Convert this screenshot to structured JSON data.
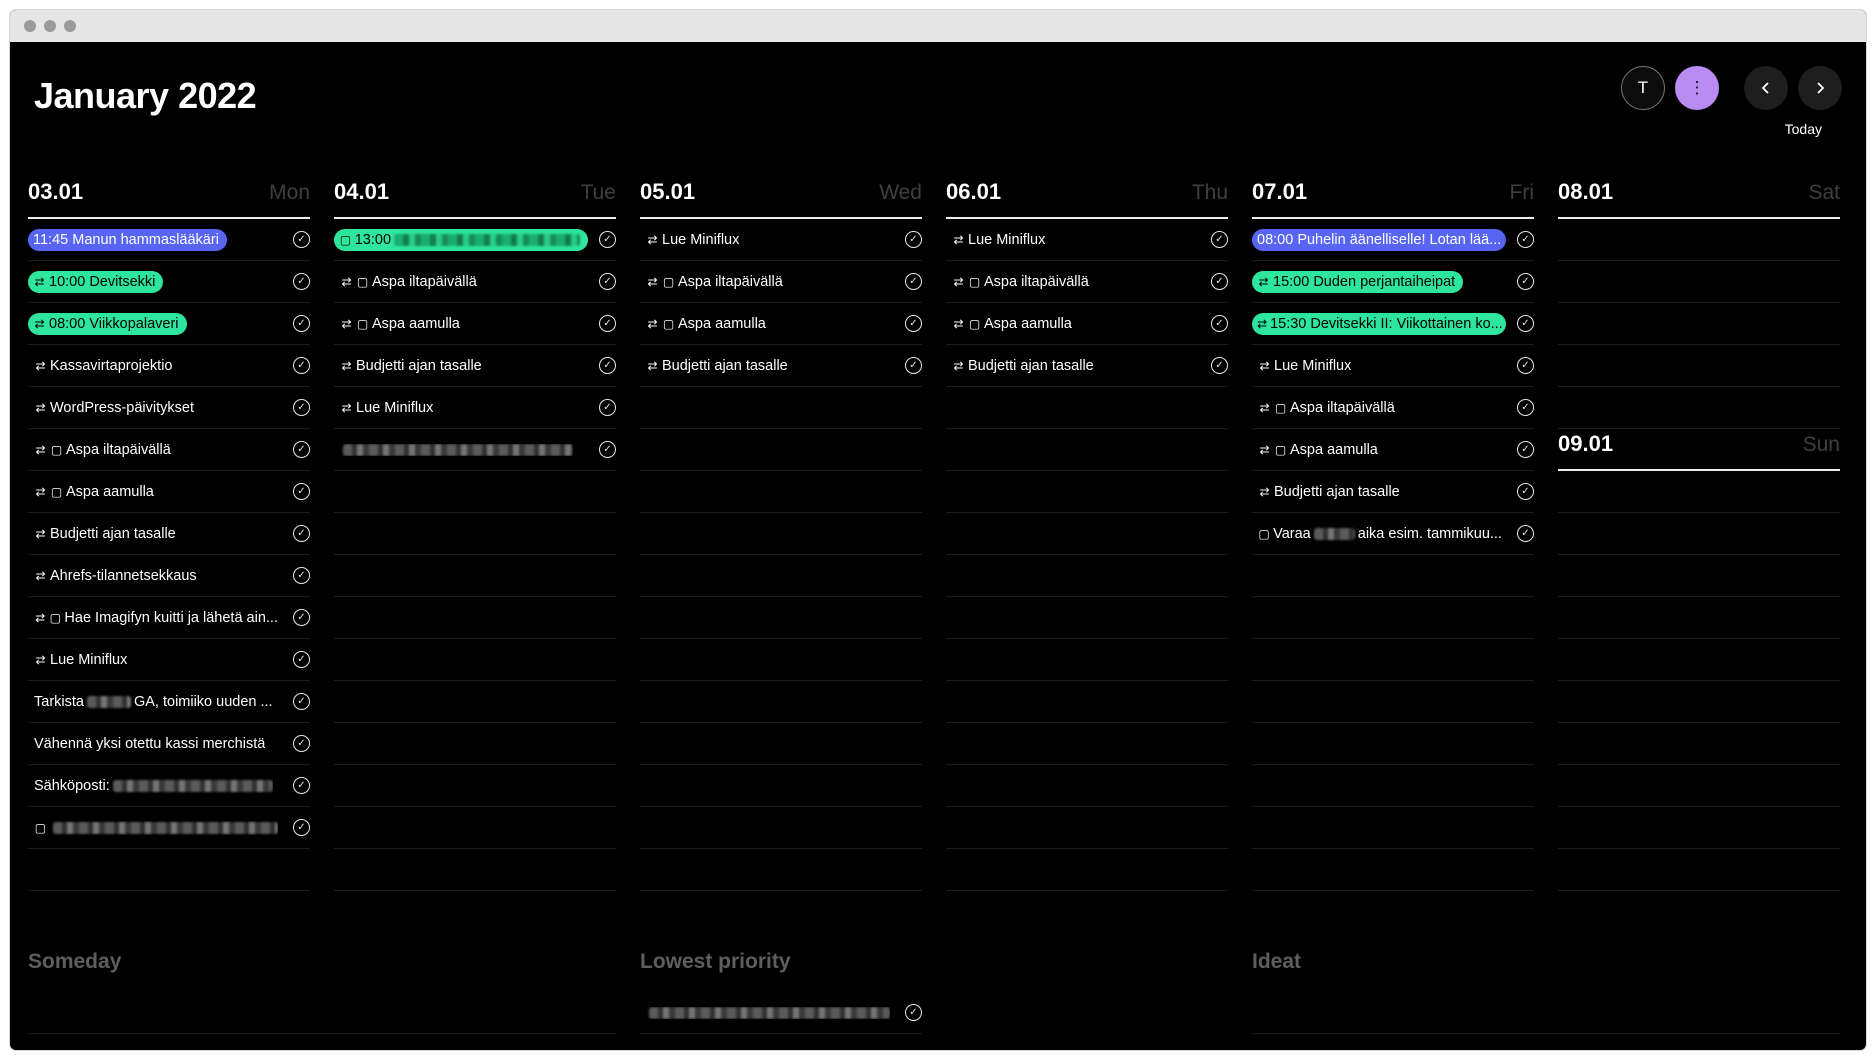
{
  "window": {
    "title": "January 2022"
  },
  "header": {
    "title": "January 2022",
    "user_initial": "T",
    "menu_icon": "kebab-menu-icon",
    "today_label": "Today",
    "accent": "#b98cf3"
  },
  "colors": {
    "pill_blue": "#5865f2",
    "pill_green": "#2ee59d"
  },
  "days": [
    {
      "date": "03.01",
      "name": "Mon",
      "tasks": [
        {
          "text": "11:45 Manun hammaslääkäri",
          "style": "blue",
          "icon": ""
        },
        {
          "text": "10:00 Devitsekki",
          "style": "green",
          "icon": "repeat"
        },
        {
          "text": "08:00 Viikkopalaveri",
          "style": "green",
          "icon": "repeat"
        },
        {
          "text": "Kassavirtaprojektio",
          "icon": "repeat"
        },
        {
          "text": "WordPress-päivitykset",
          "icon": "repeat"
        },
        {
          "text": "Aspa iltapäivällä",
          "icon": "repeat-note"
        },
        {
          "text": "Aspa aamulla",
          "icon": "repeat-note"
        },
        {
          "text": "Budjetti ajan tasalle",
          "icon": "repeat"
        },
        {
          "text": "Ahrefs-tilannetsekkaus",
          "icon": "repeat"
        },
        {
          "text": "Hae Imagifyn kuitti ja lähetä ain...",
          "icon": "repeat-note"
        },
        {
          "text": "Lue Miniflux",
          "icon": "repeat"
        },
        {
          "text": "Tarkista",
          "text2": "GA, toimiiko uuden ...",
          "icon": "",
          "blur_mid": true
        },
        {
          "text": "Vähennä yksi otettu kassi merchistä",
          "icon": ""
        },
        {
          "text": "Sähköposti: ",
          "icon": "",
          "blur_after": true
        },
        {
          "text": "",
          "icon": "note",
          "blur_after": true
        }
      ],
      "empty_rows": 1
    },
    {
      "date": "04.01",
      "name": "Tue",
      "tasks": [
        {
          "text": "13:00",
          "style": "green",
          "icon": "note",
          "blur_after": true
        },
        {
          "text": "Aspa iltapäivällä",
          "icon": "repeat-note"
        },
        {
          "text": "Aspa aamulla",
          "icon": "repeat-note"
        },
        {
          "text": "Budjetti ajan tasalle",
          "icon": "repeat"
        },
        {
          "text": "Lue Miniflux",
          "icon": "repeat"
        },
        {
          "text": "",
          "icon": "",
          "blur_after": true
        }
      ],
      "empty_rows": 10
    },
    {
      "date": "05.01",
      "name": "Wed",
      "tasks": [
        {
          "text": "Lue Miniflux",
          "icon": "repeat"
        },
        {
          "text": "Aspa iltapäivällä",
          "icon": "repeat-note"
        },
        {
          "text": "Aspa aamulla",
          "icon": "repeat-note"
        },
        {
          "text": "Budjetti ajan tasalle",
          "icon": "repeat"
        }
      ],
      "empty_rows": 12
    },
    {
      "date": "06.01",
      "name": "Thu",
      "tasks": [
        {
          "text": "Lue Miniflux",
          "icon": "repeat"
        },
        {
          "text": "Aspa iltapäivällä",
          "icon": "repeat-note"
        },
        {
          "text": "Aspa aamulla",
          "icon": "repeat-note"
        },
        {
          "text": "Budjetti ajan tasalle",
          "icon": "repeat"
        }
      ],
      "empty_rows": 12
    },
    {
      "date": "07.01",
      "name": "Fri",
      "tasks": [
        {
          "text": "08:00 Puhelin äänelliselle! Lotan lää...",
          "style": "blue",
          "icon": ""
        },
        {
          "text": "15:00 Duden perjantaiheipat",
          "style": "green",
          "icon": "repeat"
        },
        {
          "text": "15:30 Devitsekki II: Viikottainen ko...",
          "style": "green",
          "icon": "repeat"
        },
        {
          "text": "Lue Miniflux",
          "icon": "repeat"
        },
        {
          "text": "Aspa iltapäivällä",
          "icon": "repeat-note"
        },
        {
          "text": "Aspa aamulla",
          "icon": "repeat-note"
        },
        {
          "text": "Budjetti ajan tasalle",
          "icon": "repeat"
        },
        {
          "text": "Varaa",
          "text2": "aika esim. tammikuu...",
          "icon": "note",
          "blur_mid": true
        }
      ],
      "empty_rows": 8
    },
    {
      "date": "08.01",
      "name": "Sat",
      "tasks": [],
      "empty_rows": 5
    },
    {
      "date": "09.01",
      "name": "Sun",
      "tasks": [],
      "empty_rows": 10
    }
  ],
  "sections": [
    {
      "title": "Someday",
      "tasks": []
    },
    {
      "title": "Lowest priority",
      "tasks": [
        {
          "text": "",
          "blur_after": true
        }
      ]
    },
    {
      "title": "Ideat",
      "tasks": []
    }
  ]
}
